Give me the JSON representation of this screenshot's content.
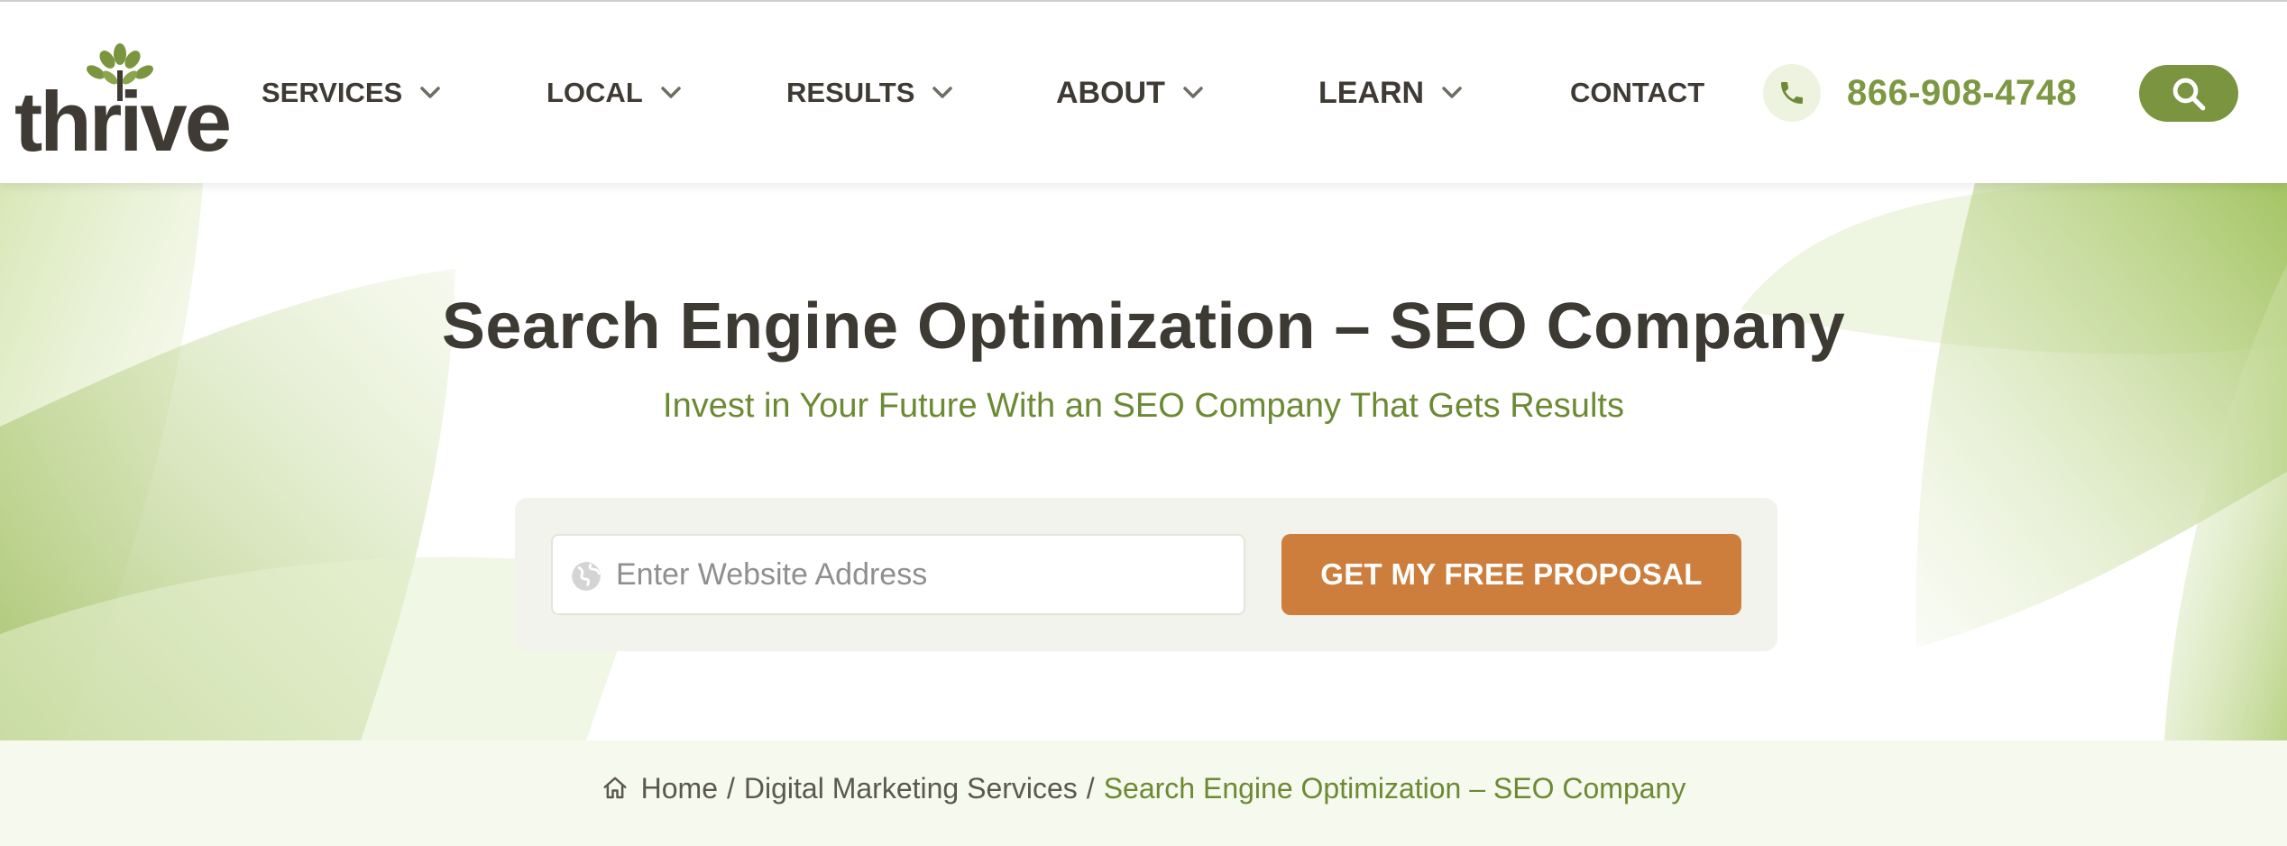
{
  "brand": {
    "logo_text": "thrive",
    "logo_color": "#3f3b34",
    "accent_color": "#7a9440"
  },
  "nav": {
    "items": [
      {
        "label": "SERVICES",
        "has_dropdown": true
      },
      {
        "label": "LOCAL",
        "has_dropdown": true
      },
      {
        "label": "RESULTS",
        "has_dropdown": true
      },
      {
        "label": "ABOUT",
        "has_dropdown": true
      },
      {
        "label": "LEARN",
        "has_dropdown": true
      },
      {
        "label": "CONTACT",
        "has_dropdown": false
      }
    ],
    "phone_icon": "phone-icon",
    "phone_number": "866-908-4748",
    "search_icon": "search-icon"
  },
  "hero": {
    "title": "Search Engine Optimization – SEO Company",
    "subtitle": "Invest in Your Future With an SEO Company That Gets Results",
    "input_icon": "globe-icon",
    "input_placeholder": "Enter Website Address",
    "input_value": "",
    "cta_label": "GET MY FREE PROPOSAL",
    "cta_color": "#cd7e3d"
  },
  "breadcrumb": {
    "home_icon": "home-icon",
    "items": [
      "Home",
      "Digital Marketing Services"
    ],
    "separator": "/",
    "current": "Search Engine Optimization – SEO Company"
  }
}
